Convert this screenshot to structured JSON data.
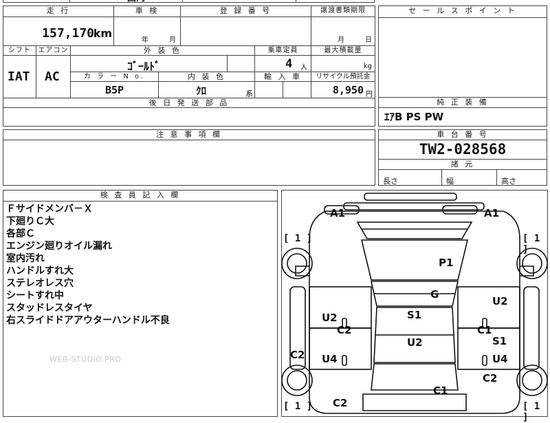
{
  "top_partial": {
    "text1": "国内",
    "text2": ""
  },
  "vehicle": {
    "mileage_header": "走 行",
    "mileage_value": "157,170",
    "mileage_unit": "km",
    "inspection_header": "車 検",
    "inspection_year": "年",
    "inspection_month": "月",
    "registration_header": "登 録 番 号",
    "registration_value": "",
    "transfer_header": "譲渡書類期限",
    "transfer_month": "月",
    "transfer_day": "日",
    "shift_header": "シフト",
    "shift_value": "IAT",
    "aircon_header": "エアコン",
    "aircon_value": "AC",
    "exterior_header": "外 装 色",
    "exterior_value": "ｺﾞｰﾙﾄﾞ",
    "capacity_header": "乗車定員",
    "capacity_value": "4",
    "capacity_unit": "人",
    "maxload_header": "最大積載量",
    "maxload_unit": "kg",
    "colorno_header": "カ ラ ー N o.",
    "colorno_value": "B5P",
    "interior_header": "内 装 色",
    "interior_value": "ｸﾛ",
    "interior_suffix": "系",
    "import_header": "輸 入 車",
    "recycle_header": "リサイクル預託金",
    "recycle_value": "8,950",
    "recycle_unit": "円",
    "shipping_header": "後 日 発 送 部 品"
  },
  "sales_point": {
    "header": "セ ー ル ス ポ イ ン ト"
  },
  "genuine": {
    "header": "純 正 装 備",
    "value": "ｴｱB PS PW"
  },
  "caution": {
    "header": "注 意 事 項 欄"
  },
  "chassis": {
    "header": "車 台 番 号",
    "value": "TW2-028568",
    "dims_header": "諸 元",
    "length_label": "長さ",
    "width_label": "幅",
    "height_label": "高さ"
  },
  "inspector": {
    "header": "検 査 員 記 入 欄",
    "notes": [
      "Ｆサイドメンバ－Ｘ",
      "下廻りＣ大",
      "各部Ｃ",
      "エンジン廻りオイル漏れ",
      "室内汚れ",
      "ハンドルすれ大",
      "ステレオレス穴",
      "シートすれ中",
      "スタッドレスタイヤ",
      "右スライドドアアウターハンドル不良"
    ]
  },
  "watermark": "WEB-STUDIO.PRO",
  "diagram": {
    "codes": {
      "a1_left": "A1",
      "a1_right": "A1",
      "p1": "P1",
      "g": "G",
      "u2_right_top": "U2",
      "u2_left": "U2",
      "c2_left_mid": "C2",
      "s1_center": "S1",
      "c1_right_mid": "C1",
      "s1_right": "S1",
      "u2_center": "U2",
      "c2_left_low": "C2",
      "u4_left": "U4",
      "u4_right": "U4",
      "c2_right_low": "C2",
      "c1_bottom": "C1",
      "c2_bottom": "C2"
    },
    "tires": {
      "front_left": "1",
      "front_right": "1",
      "rear_left": "1",
      "rear_right": "1"
    }
  }
}
